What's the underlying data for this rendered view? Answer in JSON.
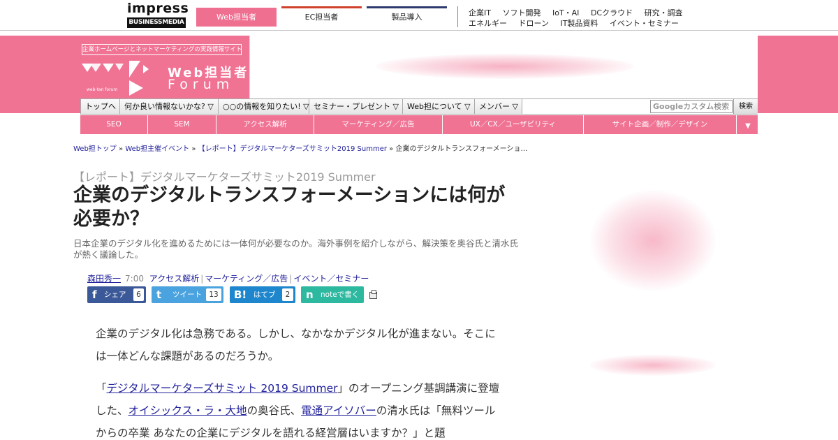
{
  "network": {
    "impress_word": "impress",
    "impress_sub": "BUSINESSMEDIA",
    "tabs": [
      "Web担当者",
      "EC担当者",
      "製品導入"
    ],
    "links_row1": [
      "企業IT",
      "ソフト開発",
      "IoT・AI",
      "DCクラウド",
      "研究・調査"
    ],
    "links_row2": [
      "エネルギー",
      "ドローン",
      "IT製品資料",
      "イベント・セミナー"
    ]
  },
  "header": {
    "tagline": "企業ホームページとネットマーケティングの実践情報サイト",
    "logo_web": "Web担当者",
    "logo_forum": "Forum",
    "logo_small": "web-tan forum"
  },
  "menu": {
    "items": [
      "トップへ",
      "何か良い情報ないかな? ▽",
      "○○の情報を知りたい! ▽",
      "セミナー・プレゼント ▽",
      "Web担について ▽",
      "メンバー ▽"
    ],
    "search_brand": "Google",
    "search_placeholder": "カスタム検索",
    "search_button": "検索"
  },
  "categories": [
    "SEO",
    "SEM",
    "アクセス解析",
    "マーケティング／広告",
    "UX／CX／ユーザビリティ",
    "サイト企画／制作／デザイン"
  ],
  "category_more": "▼",
  "breadcrumb": {
    "items": [
      "Web担トップ",
      "Web担主催イベント",
      "【レポート】デジタルマーケターズサミット2019 Summer"
    ],
    "current": "企業のデジタルトランスフォーメーショ…",
    "sep": "»"
  },
  "article": {
    "series": "【レポート】デジタルマーケターズサミット2019 Summer",
    "title_line1": "企業のデジタルトランスフォーメーションには何が",
    "title_line2": "必要か？",
    "lead": "日本企業のデジタル化を進めるためには一体何が必要なのか。海外事例を紹介しながら、解決策を奥谷氏と清水氏が熱く議論した。",
    "author": "森田秀一",
    "time": "7:00",
    "tags": [
      "アクセス解析",
      "マーケティング／広告",
      "イベント／セミナー"
    ]
  },
  "share": {
    "facebook": {
      "icon": "f",
      "label": "シェア",
      "count": "6"
    },
    "twitter": {
      "icon": "t",
      "label": "ツイート",
      "count": "13"
    },
    "hatena": {
      "icon": "B!",
      "label": "はてブ",
      "count": "2"
    },
    "note": {
      "icon": "n",
      "label": "noteで書く"
    }
  },
  "body": {
    "p1": "企業のデジタル化は急務である。しかし、なかなかデジタル化が進まない。そこには一体どんな課題があるのだろうか。",
    "p2_open": "「",
    "p2_link1": "デジタルマーケターズサミット 2019 Summer",
    "p2_t1": "」のオープニング基調講演に登壇した、",
    "p2_link2": "オイシックス・ラ・大地",
    "p2_t2": "の奥谷氏、",
    "p2_link3": "電通アイソバー",
    "p2_t3": "の清水氏は「無料ツールからの卒業 あなたの企業にデジタルを語れる経営層はいますか？」と題"
  }
}
